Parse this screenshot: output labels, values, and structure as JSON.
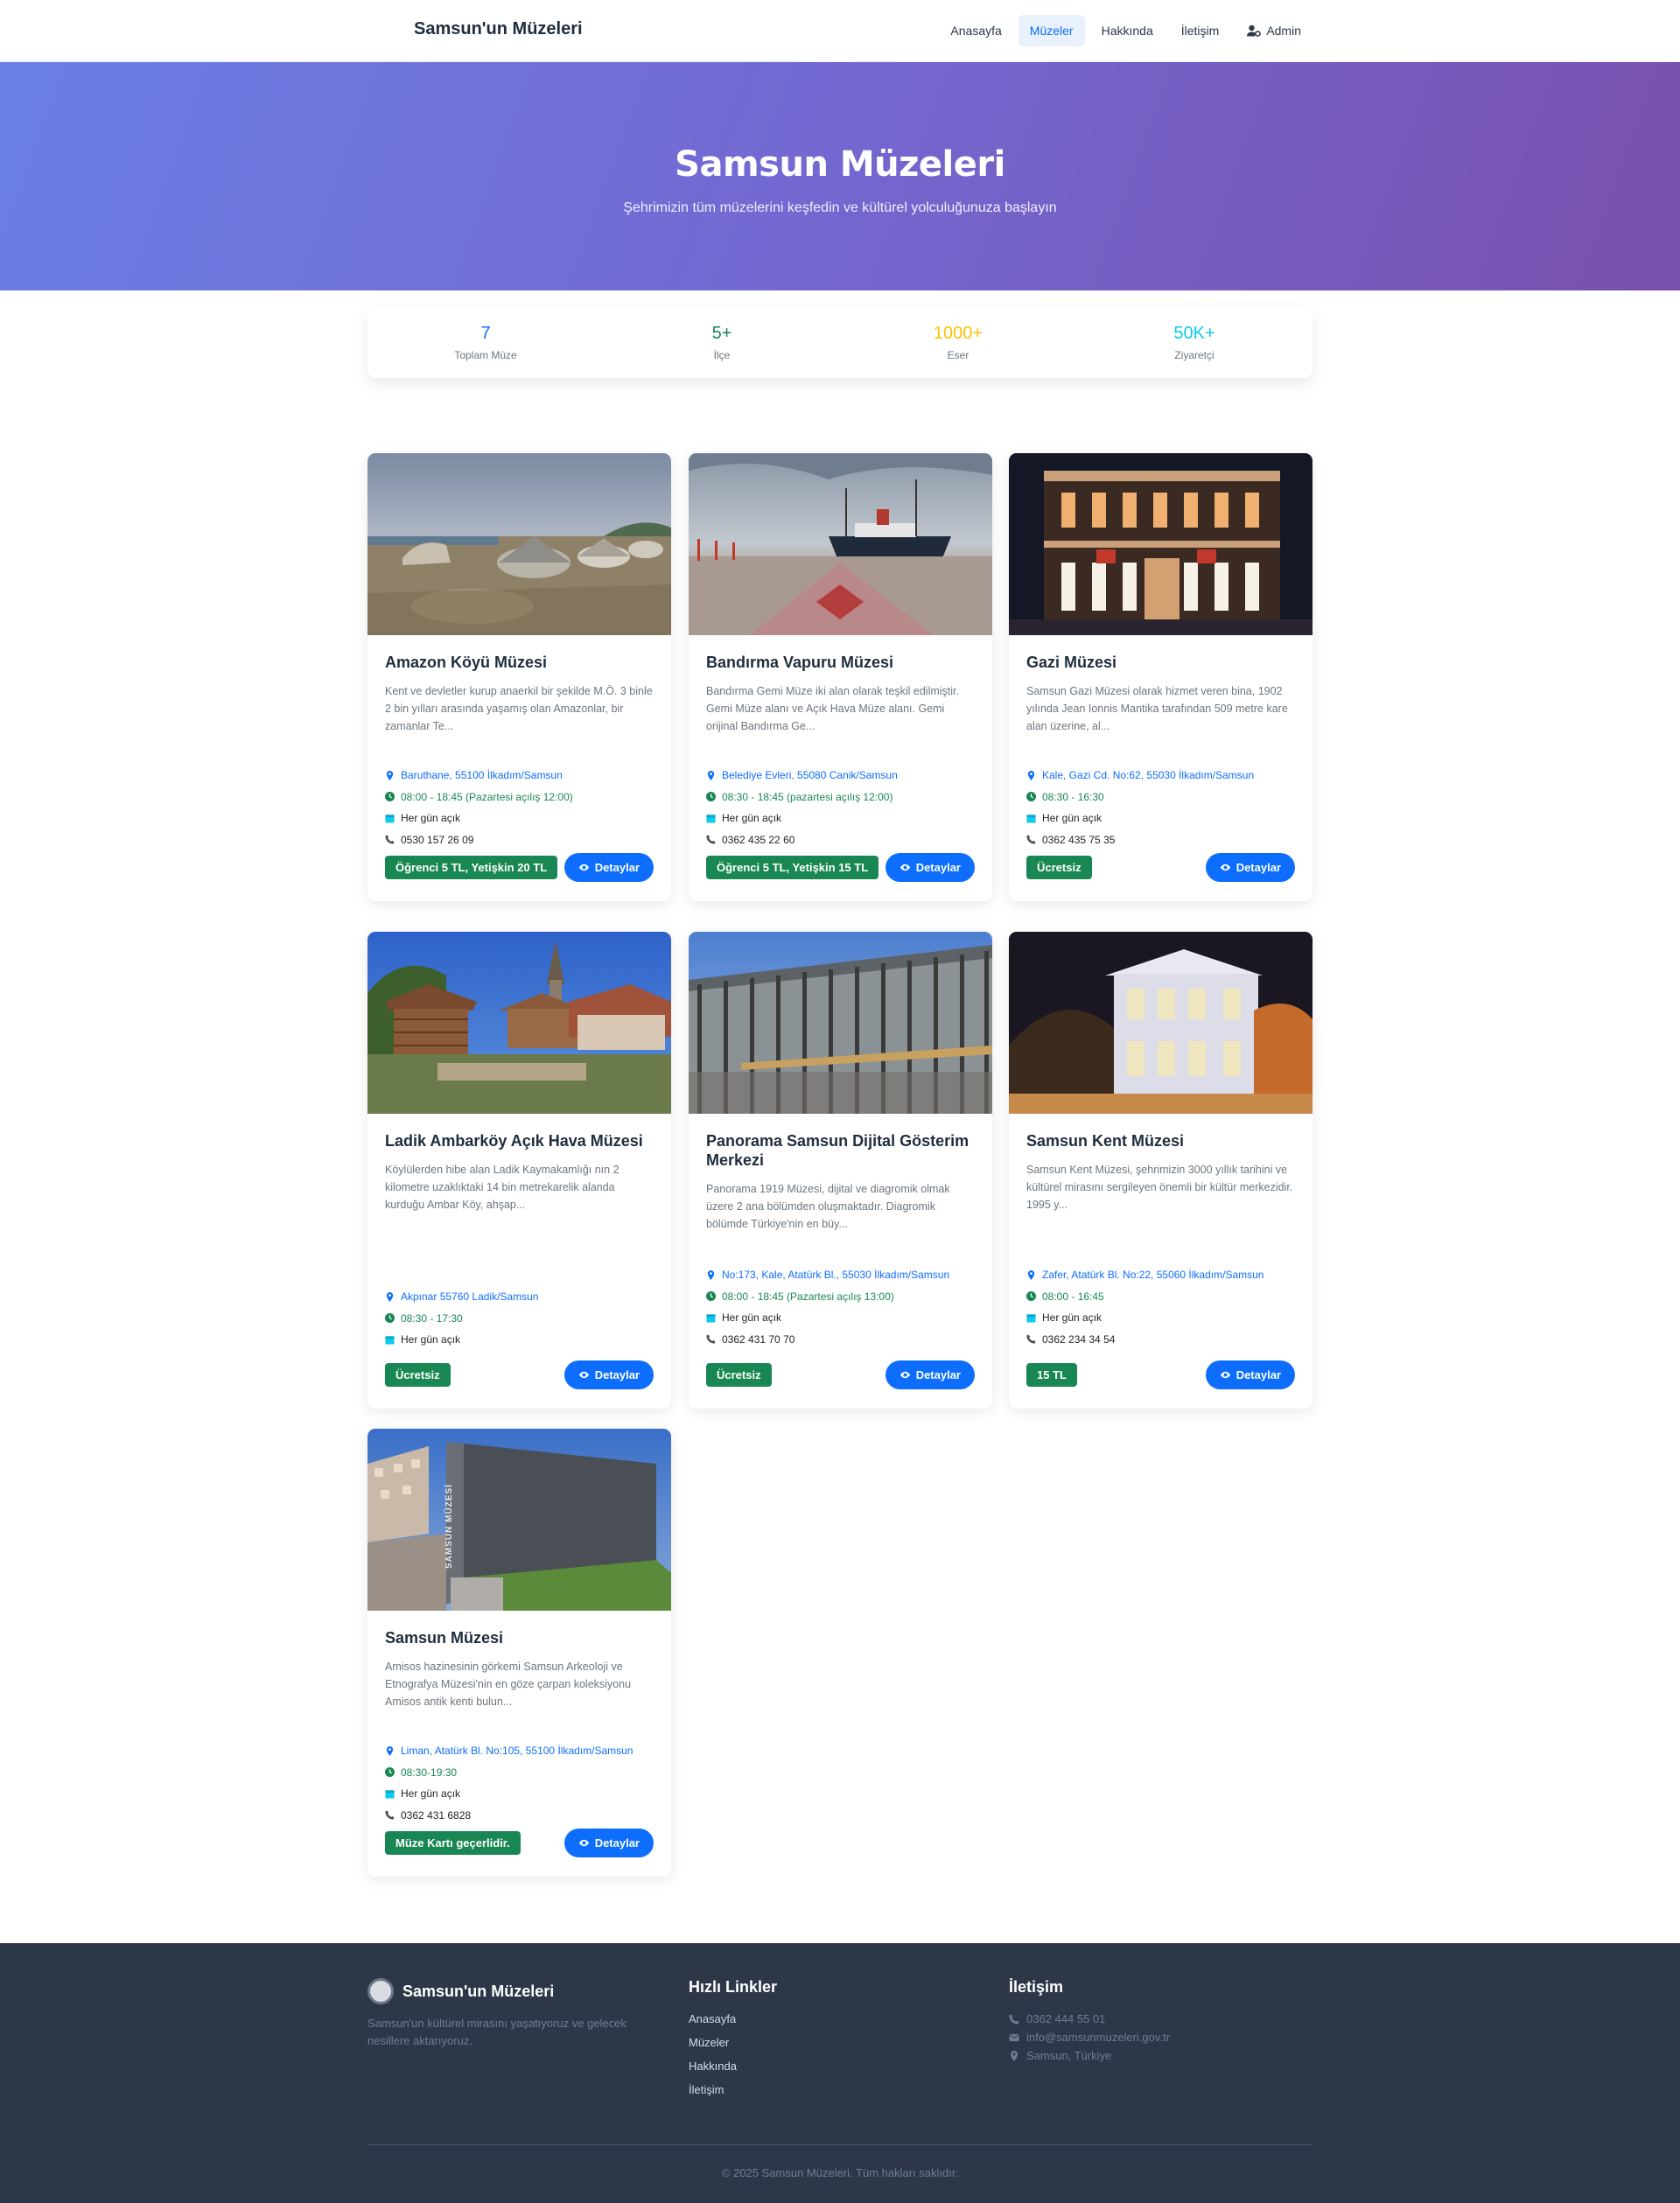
{
  "nav": {
    "brand": "Samsun'un Müzeleri",
    "items": [
      {
        "label": "Anasayfa",
        "active": false
      },
      {
        "label": "Müzeler",
        "active": true
      },
      {
        "label": "Hakkında",
        "active": false
      },
      {
        "label": "İletişim",
        "active": false
      },
      {
        "label": "Admin",
        "icon": "user-cog-icon"
      }
    ]
  },
  "hero": {
    "title": "Samsun Müzeleri",
    "subtitle": "Şehrimizin tüm müzelerini keşfedin ve kültürel yolculuğunuza başlayın"
  },
  "stats": [
    {
      "value": "7",
      "label": "Toplam Müze",
      "color": "#0d6efd"
    },
    {
      "value": "5+",
      "label": "İlçe",
      "color": "#198754"
    },
    {
      "value": "1000+",
      "label": "Eser",
      "color": "#ffc107"
    },
    {
      "value": "50K+",
      "label": "Ziyaretçi",
      "color": "#0dcaf0"
    }
  ],
  "museums": [
    {
      "title": "Amazon Köyü Müzesi",
      "description": "Kent ve devletler kurup anaerkil bir şekilde M.Ö. 3 binle 2 bin yılları arasında yaşamış olan Amazonlar, bir zamanlar Te...",
      "location": "Baruthane, 55100 İlkadım/Samsun",
      "hours": "08:00 - 18:45 (Pazartesi açılış 12:00)",
      "days": "Her gün açık",
      "phone": "0530 157 26 09",
      "price": "Öğrenci 5 TL, Yetişkin 20 TL",
      "detail_label": "Detaylar"
    },
    {
      "title": "Bandırma Vapuru Müzesi",
      "description": "Bandırma Gemi Müze iki alan olarak teşkil edilmiştir. Gemi Müze alanı ve Açık Hava Müze alanı. Gemi orijinal Bandırma Ge...",
      "location": "Belediye Evleri, 55080 Canik/Samsun",
      "hours": "08:30 - 18:45 (pazartesi açılış 12:00)",
      "days": "Her gün açık",
      "phone": "0362 435 22 60",
      "price": "Öğrenci 5 TL, Yetişkin 15 TL",
      "detail_label": "Detaylar"
    },
    {
      "title": "Gazi Müzesi",
      "description": "Samsun Gazi Müzesi olarak hizmet veren bina, 1902 yılında Jean Ionnis Mantika tarafından 509 metre kare alan üzerine, al...",
      "location": "Kale, Gazi Cd. No:62, 55030 İlkadım/Samsun",
      "hours": "08:30 - 16:30",
      "days": "Her gün açık",
      "phone": "0362 435 75 35",
      "price": "Ücretsiz",
      "detail_label": "Detaylar"
    },
    {
      "title": "Ladik Ambarköy Açık Hava Müzesi",
      "description": "Köylülerden hibe alan Ladik Kaymakamlığı nın 2 kilometre uzaklıktaki 14 bin metrekarelik alanda kurduğu Ambar Köy, ahşap...",
      "location": "Akpınar 55760 Ladik/Samsun",
      "hours": "08:30 - 17:30",
      "days": "Her gün açık",
      "phone": "",
      "price": "Ücretsiz",
      "detail_label": "Detaylar"
    },
    {
      "title": "Panorama Samsun Dijital Gösterim Merkezi",
      "description": "Panorama 1919 Müzesi, dijital ve diagromik olmak üzere 2 ana bölümden oluşmaktadır. Diagromik bölümde Türkiye'nin en büy...",
      "location": "No:173, Kale, Atatürk Bl., 55030 İlkadım/Samsun",
      "hours": "08:00 - 18:45 (Pazartesi açılış 13:00)",
      "days": "Her gün açık",
      "phone": "0362 431 70 70",
      "price": "Ücretsiz",
      "detail_label": "Detaylar"
    },
    {
      "title": "Samsun Kent Müzesi",
      "description": "Samsun Kent Müzesi, şehrimizin 3000 yıllık tarihini ve kültürel mirasını sergileyen önemli bir kültür merkezidir. 1995 y...",
      "location": "Zafer, Atatürk Bl. No:22, 55060 İlkadım/Samsun",
      "hours": "08:00 - 16:45",
      "days": "Her gün açık",
      "phone": "0362 234 34 54",
      "price": "15 TL",
      "detail_label": "Detaylar"
    },
    {
      "title": "Samsun Müzesi",
      "description": "Amisos hazinesinin görkemi Samsun Arkeoloji ve Etnografya Müzesi'nin en göze çarpan koleksiyonu Amisos antik kenti bulun...",
      "location": "Liman, Atatürk Bl. No:105, 55100 İlkadım/Samsun",
      "hours": "08:30-19:30",
      "days": "Her gün açık",
      "phone": "0362 431 6828",
      "price": "Müze Kartı geçerlidir.",
      "detail_label": "Detaylar",
      "image_text": "SAMSUN MÜZESİ"
    }
  ],
  "footer": {
    "brand": "Samsun'un Müzeleri",
    "about": "Samsun'un kültürel mirasını yaşatıyoruz ve gelecek nesillere aktarıyoruz.",
    "quick_links_title": "Hızlı Linkler",
    "quick_links": [
      "Anasayfa",
      "Müzeler",
      "Hakkında",
      "İletişim"
    ],
    "contact_title": "İletişim",
    "phone": "0362 444 55 01",
    "email": "info@samsunmuzeleri.gov.tr",
    "address": "Samsun, Türkiye",
    "copyright": "© 2025 Samsun Müzeleri. Tüm hakları saklıdır."
  }
}
